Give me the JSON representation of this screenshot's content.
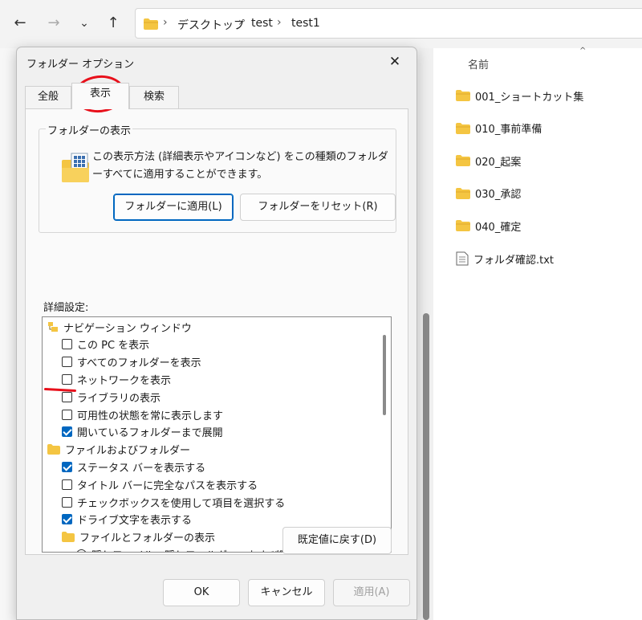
{
  "explorer": {
    "breadcrumb": [
      "デスクトップ",
      "test",
      "test1"
    ],
    "column_header": "名前",
    "files": [
      {
        "name": "001_ショートカット集",
        "type": "folder"
      },
      {
        "name": "010_事前準備",
        "type": "folder"
      },
      {
        "name": "020_起案",
        "type": "folder"
      },
      {
        "name": "030_承認",
        "type": "folder"
      },
      {
        "name": "040_確定",
        "type": "folder"
      },
      {
        "name": "フォルダ確認.txt",
        "type": "text-file"
      }
    ]
  },
  "dialog": {
    "title": "フォルダー オプション",
    "tabs": [
      "全般",
      "表示",
      "検索"
    ],
    "active_tab": "表示",
    "group_label": "フォルダーの表示",
    "group_text": "この表示方法 (詳細表示やアイコンなど) をこの種類のフォルダーすべてに適用することができます。",
    "apply_to_folders_button": "フォルダーに適用(L)",
    "reset_folders_button": "フォルダーをリセット(R)",
    "advanced_label": "詳細設定:",
    "tree": [
      {
        "label": "ナビゲーション ウィンドウ",
        "kind": "category",
        "level": 0
      },
      {
        "label": "この PC を表示",
        "kind": "checkbox",
        "checked": false,
        "level": 1
      },
      {
        "label": "すべてのフォルダーを表示",
        "kind": "checkbox",
        "checked": false,
        "level": 1
      },
      {
        "label": "ネットワークを表示",
        "kind": "checkbox",
        "checked": false,
        "level": 1
      },
      {
        "label": "ライブラリの表示",
        "kind": "checkbox",
        "checked": false,
        "level": 1
      },
      {
        "label": "可用性の状態を常に表示します",
        "kind": "checkbox",
        "checked": false,
        "level": 1
      },
      {
        "label": "開いているフォルダーまで展開",
        "kind": "checkbox",
        "checked": true,
        "level": 1
      },
      {
        "label": "ファイルおよびフォルダー",
        "kind": "folder",
        "level": 0
      },
      {
        "label": "ステータス バーを表示する",
        "kind": "checkbox",
        "checked": true,
        "level": 1
      },
      {
        "label": "タイトル バーに完全なパスを表示する",
        "kind": "checkbox",
        "checked": false,
        "level": 1
      },
      {
        "label": "チェックボックスを使用して項目を選択する",
        "kind": "checkbox",
        "checked": false,
        "level": 1
      },
      {
        "label": "ドライブ文字を表示する",
        "kind": "checkbox",
        "checked": true,
        "level": 1
      },
      {
        "label": "ファイルとフォルダーの表示",
        "kind": "folder",
        "level": 1
      },
      {
        "label": "隠しファイル、隠しフォルダー、および隠しドライブを表示する",
        "kind": "radio",
        "checked": false,
        "level": 2
      }
    ],
    "restore_defaults_button": "既定値に戻す(D)",
    "ok_button": "OK",
    "cancel_button": "キャンセル",
    "apply_button": "適用(A)"
  },
  "colors": {
    "accent": "#0067c0",
    "annotation": "#e8101b",
    "folder": "#f4c542"
  }
}
